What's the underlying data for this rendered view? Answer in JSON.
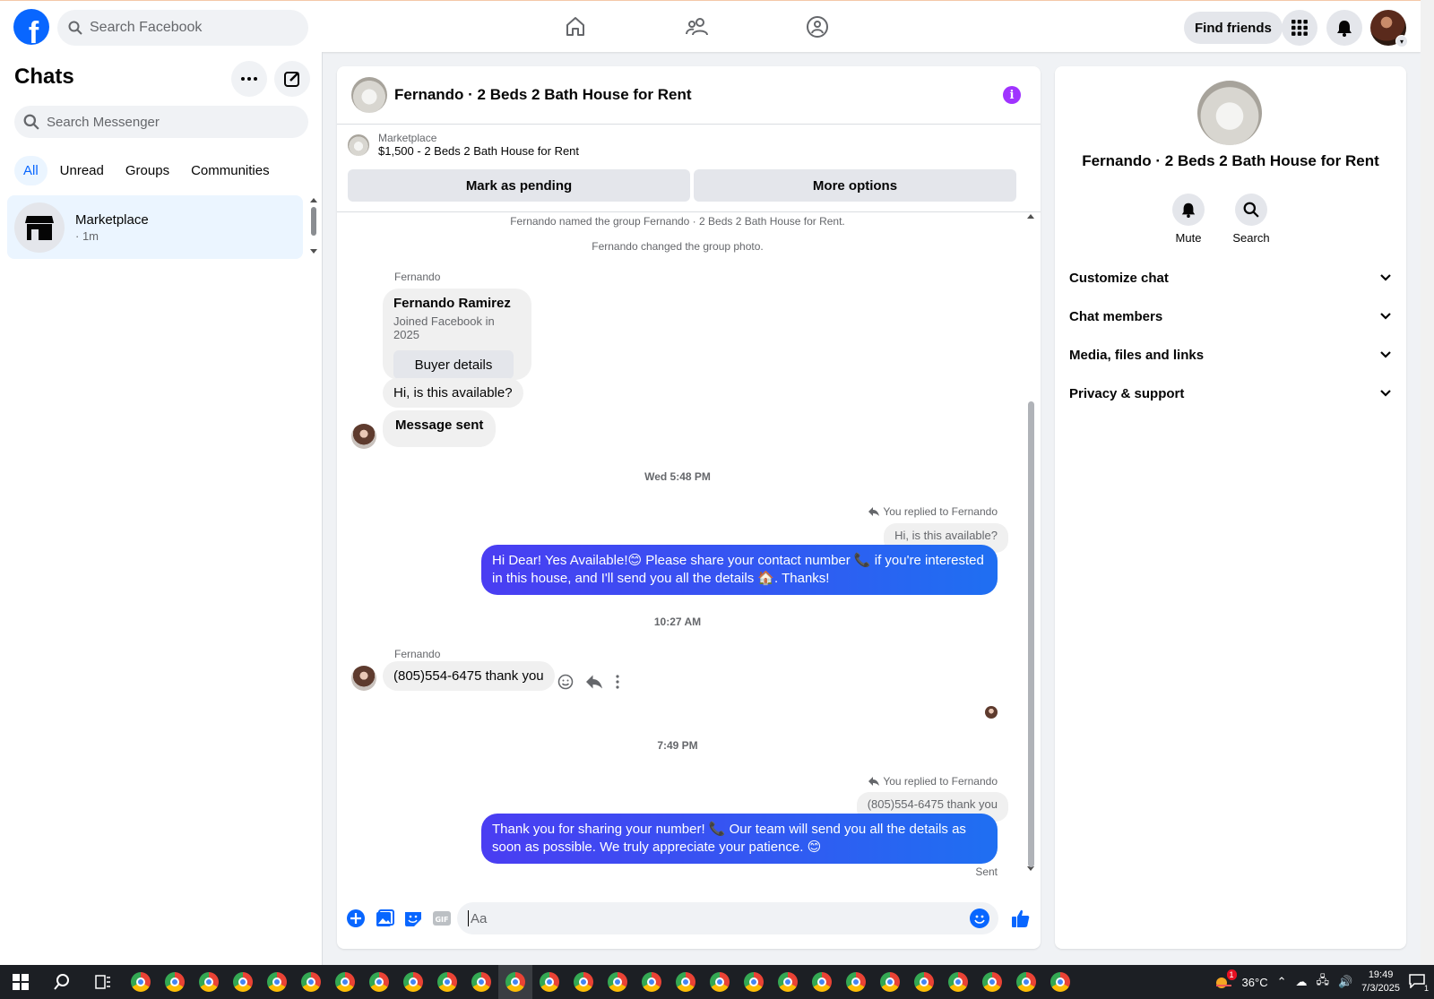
{
  "topbar": {
    "logo": "f",
    "search_placeholder": "Search Facebook",
    "find_friends": "Find friends"
  },
  "sidebar": {
    "title": "Chats",
    "search_placeholder": "Search Messenger",
    "filters": [
      "All",
      "Unread",
      "Groups",
      "Communities"
    ],
    "active_filter": "All",
    "chat": {
      "name": "Marketplace",
      "time": "· 1m"
    }
  },
  "conversation": {
    "header_title": "Fernando · 2 Beds 2 Bath House for Rent",
    "marketplace_label": "Marketplace",
    "listing": "$1,500 - 2 Beds 2 Bath House for Rent",
    "mark_pending": "Mark as pending",
    "more_options": "More options",
    "system_1": "Fernando named the group Fernando · 2 Beds 2 Bath House for Rent.",
    "system_2": "Fernando changed the group photo.",
    "sender_1": "Fernando",
    "card_name": "Fernando Ramirez",
    "card_sub": "Joined Facebook in 2025",
    "card_button": "Buyer details",
    "msg_in_1": "Hi, is this available?",
    "msg_in_2": "Message sent",
    "time_1": "Wed 5:48 PM",
    "reply_note_1": "You replied to Fernando",
    "quoted_1": "Hi, is this available?",
    "msg_out_1": "Hi Dear! Yes Available!😊 Please share your contact number 📞 if you're interested in this house, and I'll send you all the details 🏠. Thanks!",
    "time_2": "10:27 AM",
    "sender_2": "Fernando",
    "msg_in_3": "(805)554-6475 thank you",
    "time_3": "7:49 PM",
    "reply_note_2": "You replied to Fernando",
    "quoted_2": "(805)554-6475 thank you",
    "msg_out_2": "Thank you for sharing your number! 📞 Our team will send you all the details as soon as possible. We truly appreciate your patience. 😊",
    "sent_label": "Sent",
    "composer_placeholder": "Aa"
  },
  "details": {
    "title": "Fernando · 2 Beds 2 Bath House for Rent",
    "mute": "Mute",
    "search": "Search",
    "sections": [
      "Customize chat",
      "Chat members",
      "Media, files and links",
      "Privacy & support"
    ]
  },
  "taskbar": {
    "weather": "36°C",
    "weather_badge": "1",
    "time": "19:49",
    "date": "7/3/2025",
    "notif_count": "1"
  },
  "colors": {
    "brand": "#0866ff",
    "outgoing_bubble": "#3c41f0",
    "info_icon": "#a033ff"
  }
}
